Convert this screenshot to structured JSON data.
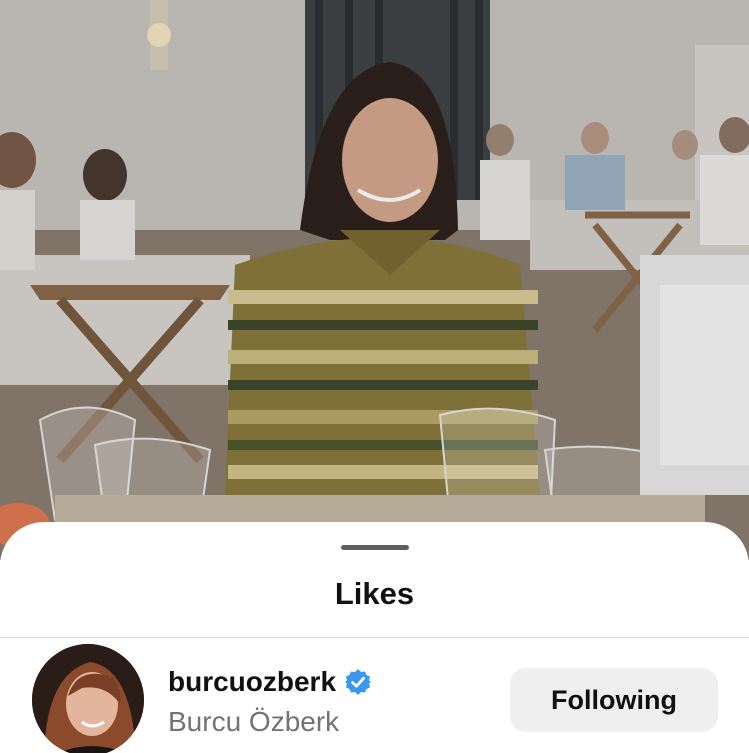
{
  "sheet": {
    "title": "Likes"
  },
  "likes": [
    {
      "username": "burcuozberk",
      "full_name": "Burcu Özberk",
      "verified": true,
      "button_label": "Following"
    }
  ],
  "colors": {
    "verified_badge": "#3897f0",
    "button_bg": "#efefef",
    "secondary_text": "#737373"
  }
}
